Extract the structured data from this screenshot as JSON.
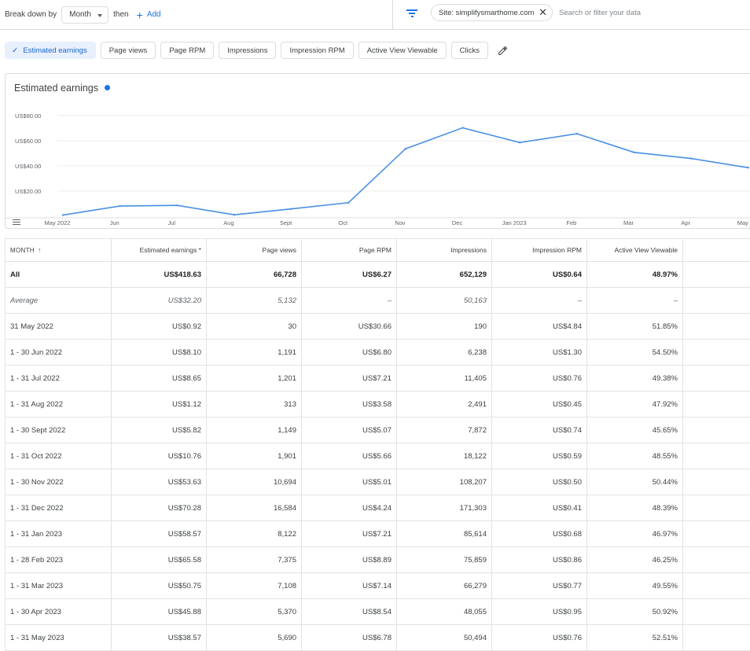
{
  "toolbar": {
    "breakdown_label": "Break down by",
    "breakdown_value": "Month",
    "then_label": "then",
    "add_label": "Add",
    "site_filter": "Site: simplifysmarthome.com",
    "search_placeholder": "Search or filter your data"
  },
  "metric_chips": [
    {
      "label": "Estimated earnings",
      "selected": true
    },
    {
      "label": "Page views",
      "selected": false
    },
    {
      "label": "Page RPM",
      "selected": false
    },
    {
      "label": "Impressions",
      "selected": false
    },
    {
      "label": "Impression RPM",
      "selected": false
    },
    {
      "label": "Active View Viewable",
      "selected": false
    },
    {
      "label": "Clicks",
      "selected": false
    }
  ],
  "chart_data": {
    "type": "line",
    "title": "Estimated earnings",
    "series_color": "#4a90e2",
    "categories": [
      "May 2022",
      "Jun",
      "Jul",
      "Aug",
      "Sept",
      "Oct",
      "Nov",
      "Dec",
      "Jan 2023",
      "Feb",
      "Mar",
      "Apr",
      "May"
    ],
    "series": [
      {
        "values": [
          0.92,
          8.1,
          8.65,
          1.12,
          5.82,
          10.76,
          53.63,
          70.28,
          58.57,
          65.58,
          50.75,
          45.88,
          38.57
        ]
      }
    ],
    "y_ticks": [
      "US$80.00",
      "US$60.00",
      "US$40.00",
      "US$20.00"
    ],
    "y_tick_values": [
      80,
      60,
      40,
      20
    ],
    "ylim": [
      0,
      80
    ],
    "grid": true
  },
  "table": {
    "headers": [
      "MONTH",
      "Estimated earnings *",
      "Page views",
      "Page RPM",
      "Impressions",
      "Impression RPM",
      "Active View Viewable"
    ],
    "total": [
      "All",
      "US$418.63",
      "66,728",
      "US$6.27",
      "652,129",
      "US$0.64",
      "48.97%"
    ],
    "average": [
      "Average",
      "US$32.20",
      "5,132",
      "–",
      "50,163",
      "–",
      "–"
    ],
    "rows": [
      [
        "31 May 2022",
        "US$0.92",
        "30",
        "US$30.66",
        "190",
        "US$4.84",
        "51.85%"
      ],
      [
        "1 - 30 Jun 2022",
        "US$8.10",
        "1,191",
        "US$6.80",
        "6,238",
        "US$1.30",
        "54.50%"
      ],
      [
        "1 - 31 Jul 2022",
        "US$8.65",
        "1,201",
        "US$7.21",
        "11,405",
        "US$0.76",
        "49.38%"
      ],
      [
        "1 - 31 Aug 2022",
        "US$1.12",
        "313",
        "US$3.58",
        "2,491",
        "US$0.45",
        "47.92%"
      ],
      [
        "1 - 30 Sept 2022",
        "US$5.82",
        "1,149",
        "US$5.07",
        "7,872",
        "US$0.74",
        "45.65%"
      ],
      [
        "1 - 31 Oct 2022",
        "US$10.76",
        "1,901",
        "US$5.66",
        "18,122",
        "US$0.59",
        "48.55%"
      ],
      [
        "1 - 30 Nov 2022",
        "US$53.63",
        "10,694",
        "US$5.01",
        "108,207",
        "US$0.50",
        "50.44%"
      ],
      [
        "1 - 31 Dec 2022",
        "US$70.28",
        "16,584",
        "US$4.24",
        "171,303",
        "US$0.41",
        "48.39%"
      ],
      [
        "1 - 31 Jan 2023",
        "US$58.57",
        "8,122",
        "US$7.21",
        "85,614",
        "US$0.68",
        "46.97%"
      ],
      [
        "1 - 28 Feb 2023",
        "US$65.58",
        "7,375",
        "US$8.89",
        "75,859",
        "US$0.86",
        "46.25%"
      ],
      [
        "1 - 31 Mar 2023",
        "US$50.75",
        "7,108",
        "US$7.14",
        "66,279",
        "US$0.77",
        "49.55%"
      ],
      [
        "1 - 30 Apr 2023",
        "US$45.88",
        "5,370",
        "US$8.54",
        "48,055",
        "US$0.95",
        "50.92%"
      ],
      [
        "1 - 31 May 2023",
        "US$38.57",
        "5,690",
        "US$6.78",
        "50,494",
        "US$0.76",
        "52.51%"
      ]
    ]
  }
}
